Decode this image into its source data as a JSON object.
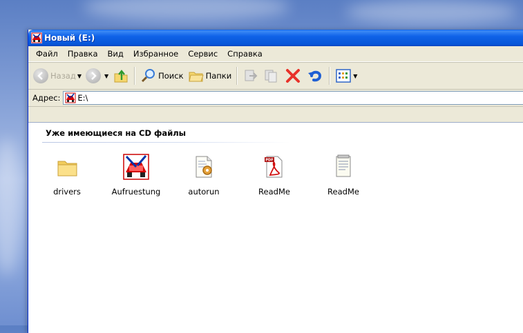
{
  "window": {
    "title": "Новый (E:)"
  },
  "menu": [
    "Файл",
    "Правка",
    "Вид",
    "Избранное",
    "Сервис",
    "Справка"
  ],
  "toolbar": {
    "back": "Назад",
    "search": "Поиск",
    "folders": "Папки"
  },
  "address": {
    "label": "Адрес:",
    "value": "E:\\"
  },
  "content": {
    "group_title": "Уже имеющиеся на CD файлы",
    "files": [
      {
        "name": "drivers",
        "icon": "folder-icon"
      },
      {
        "name": "Aufruestung",
        "icon": "car-app-icon"
      },
      {
        "name": "autorun",
        "icon": "settings-file-icon"
      },
      {
        "name": "ReadMe",
        "icon": "pdf-file-icon"
      },
      {
        "name": "ReadMe",
        "icon": "text-file-icon"
      }
    ]
  }
}
